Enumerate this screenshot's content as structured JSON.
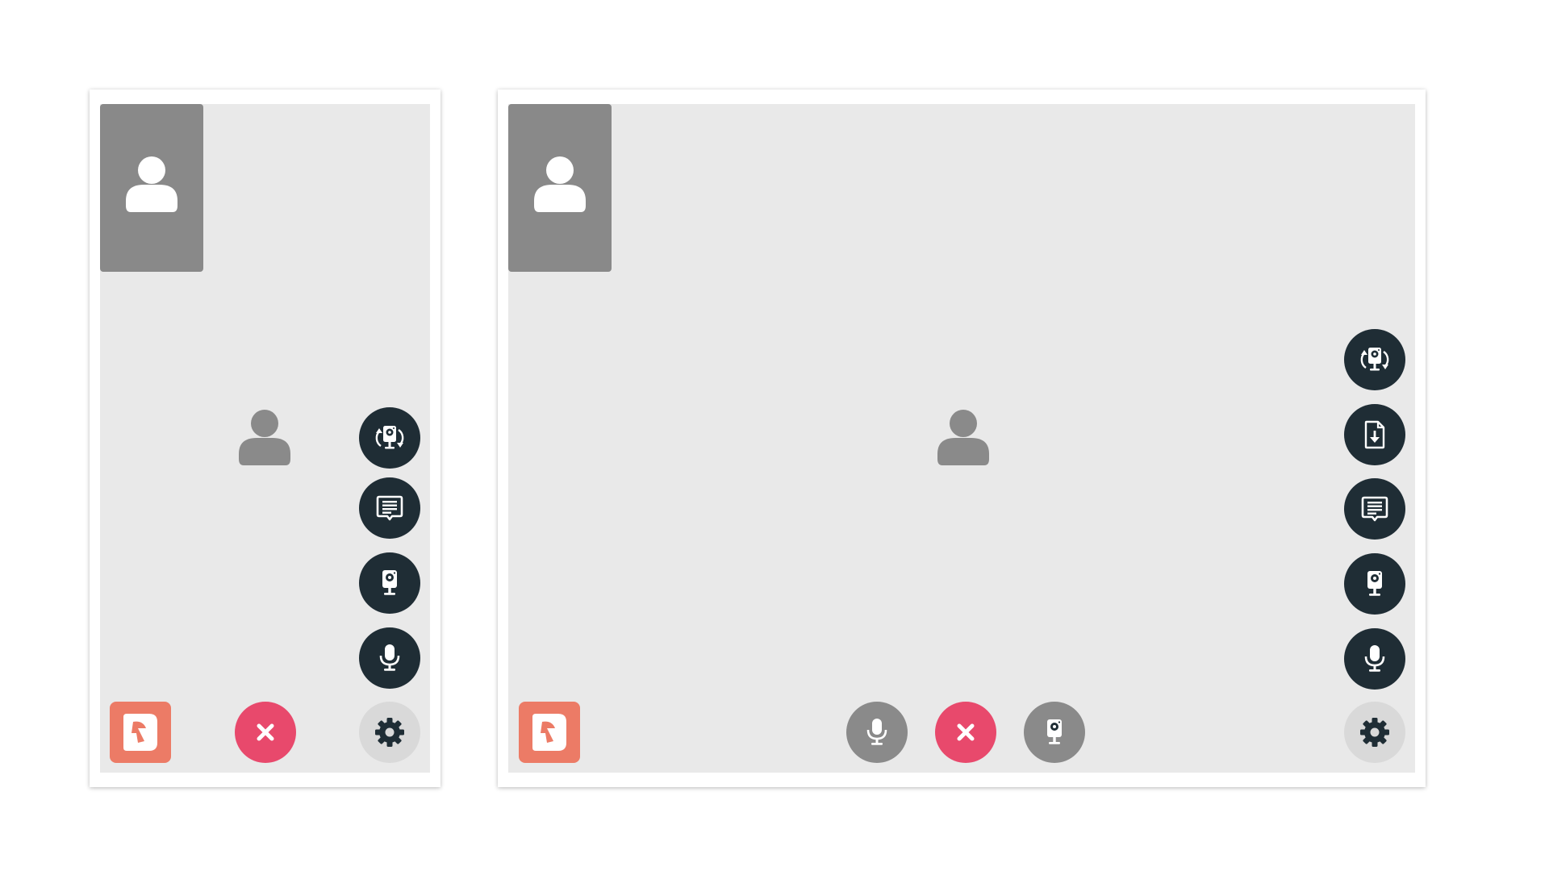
{
  "colors": {
    "page_background": "#ffffff",
    "stage_background": "#e9e9e9",
    "self_view_background": "#898989",
    "avatar_on_stage": "#8a8a8a",
    "action_button": "#1f2d35",
    "muted_toggle_button": "#8a8a8a",
    "hangup_button": "#e8496c",
    "settings_button": "#d9d9d9",
    "brand_logo_background": "#ec7b66"
  },
  "views": {
    "mobile": {
      "icons": {
        "self_avatar": "user-icon",
        "remote_avatar": "user-icon",
        "side_actions": [
          "switch-camera-icon",
          "chat-icon",
          "camera-icon",
          "microphone-icon"
        ],
        "bottom_left": "brand-logo-icon",
        "bottom_center": "close-icon",
        "bottom_right": "gear-icon"
      }
    },
    "desktop": {
      "icons": {
        "self_avatar": "user-icon",
        "remote_avatar": "user-icon",
        "side_actions": [
          "switch-camera-icon",
          "file-download-icon",
          "chat-icon",
          "camera-icon",
          "microphone-icon"
        ],
        "bottom_left": "brand-logo-icon",
        "bottom_center": [
          "microphone-icon",
          "close-icon",
          "camera-icon"
        ],
        "bottom_right": "gear-icon"
      }
    }
  }
}
